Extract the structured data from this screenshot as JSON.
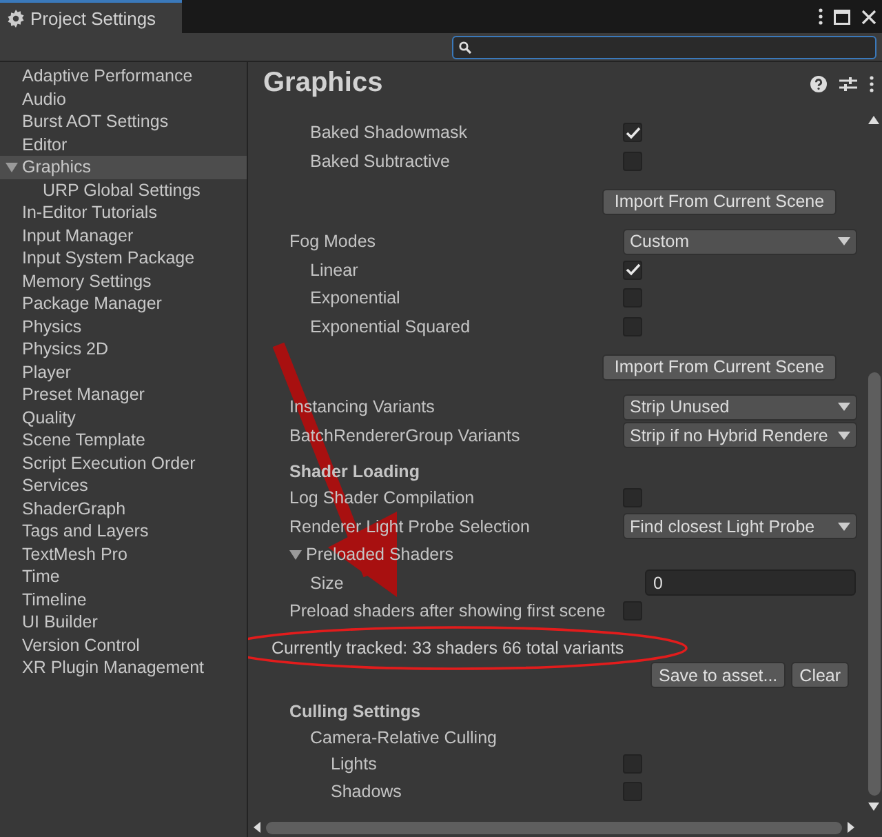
{
  "window": {
    "title": "Project Settings"
  },
  "sidebar": {
    "items": [
      {
        "label": "Adaptive Performance",
        "selected": false
      },
      {
        "label": "Audio",
        "selected": false
      },
      {
        "label": "Burst AOT Settings",
        "selected": false
      },
      {
        "label": "Editor",
        "selected": false
      },
      {
        "label": "Graphics",
        "selected": true,
        "expanded": true,
        "children": [
          {
            "label": "URP Global Settings",
            "selected": false
          }
        ]
      },
      {
        "label": "In-Editor Tutorials",
        "selected": false
      },
      {
        "label": "Input Manager",
        "selected": false
      },
      {
        "label": "Input System Package",
        "selected": false
      },
      {
        "label": "Memory Settings",
        "selected": false
      },
      {
        "label": "Package Manager",
        "selected": false
      },
      {
        "label": "Physics",
        "selected": false
      },
      {
        "label": "Physics 2D",
        "selected": false
      },
      {
        "label": "Player",
        "selected": false
      },
      {
        "label": "Preset Manager",
        "selected": false
      },
      {
        "label": "Quality",
        "selected": false
      },
      {
        "label": "Scene Template",
        "selected": false
      },
      {
        "label": "Script Execution Order",
        "selected": false
      },
      {
        "label": "Services",
        "selected": false
      },
      {
        "label": "ShaderGraph",
        "selected": false
      },
      {
        "label": "Tags and Layers",
        "selected": false
      },
      {
        "label": "TextMesh Pro",
        "selected": false
      },
      {
        "label": "Time",
        "selected": false
      },
      {
        "label": "Timeline",
        "selected": false
      },
      {
        "label": "UI Builder",
        "selected": false
      },
      {
        "label": "Version Control",
        "selected": false
      },
      {
        "label": "XR Plugin Management",
        "selected": false
      }
    ]
  },
  "panel": {
    "title": "Graphics",
    "rows": [
      {
        "kind": "group",
        "children": [
          {
            "kind": "checkbox",
            "label": "Baked Shadowmask",
            "checked": true
          },
          {
            "kind": "checkbox",
            "label": "Baked Subtractive",
            "checked": false
          }
        ]
      },
      {
        "kind": "button",
        "label": "Import From Current Scene"
      },
      {
        "kind": "dropdown",
        "label": "Fog Modes",
        "value": "Custom",
        "children": [
          {
            "kind": "checkbox",
            "label": "Linear",
            "checked": true
          },
          {
            "kind": "checkbox",
            "label": "Exponential",
            "checked": false
          },
          {
            "kind": "checkbox",
            "label": "Exponential Squared",
            "checked": false
          }
        ]
      },
      {
        "kind": "button",
        "label": "Import From Current Scene"
      },
      {
        "kind": "dropdown",
        "label": "Instancing Variants",
        "value": "Strip Unused"
      },
      {
        "kind": "dropdown",
        "label": "BatchRendererGroup Variants",
        "value": "Strip if no Hybrid Rendere"
      },
      {
        "kind": "heading",
        "label": "Shader Loading"
      },
      {
        "kind": "checkbox",
        "label": "Log Shader Compilation",
        "checked": false
      },
      {
        "kind": "dropdown",
        "label": "Renderer Light Probe Selection",
        "value": "Find closest Light Probe"
      },
      {
        "kind": "foldout",
        "label": "Preloaded Shaders",
        "expanded": true,
        "children": [
          {
            "kind": "number",
            "label": "Size",
            "value": "0"
          }
        ]
      },
      {
        "kind": "checkbox",
        "label": "Preload shaders after showing first scene",
        "checked": false
      },
      {
        "kind": "info",
        "label": "Currently tracked: 33 shaders 66 total variants"
      },
      {
        "kind": "buttons",
        "buttons": [
          "Save to asset...",
          "Clear"
        ]
      },
      {
        "kind": "heading",
        "label": "Culling Settings",
        "children": [
          {
            "kind": "label",
            "label": "Camera-Relative Culling",
            "children": [
              {
                "kind": "checkbox",
                "label": "Lights",
                "checked": false
              },
              {
                "kind": "checkbox",
                "label": "Shadows",
                "checked": false
              }
            ]
          }
        ]
      }
    ]
  }
}
